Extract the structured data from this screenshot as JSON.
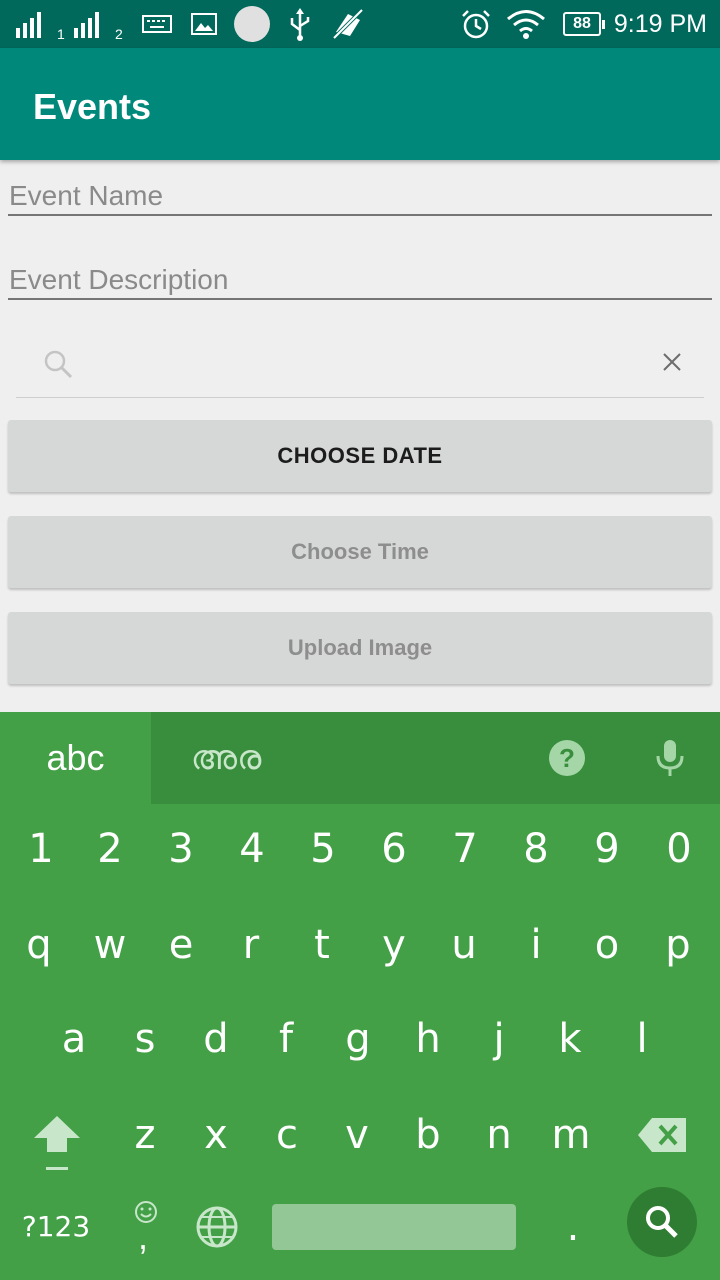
{
  "status_bar": {
    "sim1_label": "1",
    "sim2_label": "2",
    "battery": "88",
    "time": "9:19 PM"
  },
  "app_bar": {
    "title": "Events"
  },
  "form": {
    "event_name_hint": "Event Name",
    "event_description_hint": "Event Description",
    "search_value": "",
    "choose_date_label": "CHOOSE DATE",
    "choose_time_label": "Choose Time",
    "upload_image_label": "Upload Image"
  },
  "keyboard": {
    "tab_abc": "abc",
    "tab_malayalam": "അര",
    "help_label": "?",
    "number_row": [
      "1",
      "2",
      "3",
      "4",
      "5",
      "6",
      "7",
      "8",
      "9",
      "0"
    ],
    "row1": [
      "q",
      "w",
      "e",
      "r",
      "t",
      "y",
      "u",
      "i",
      "o",
      "p"
    ],
    "row2": [
      "a",
      "s",
      "d",
      "f",
      "g",
      "h",
      "j",
      "k",
      "l"
    ],
    "row3": [
      "z",
      "x",
      "c",
      "v",
      "b",
      "n",
      "m"
    ],
    "symbols_key": "?123",
    "comma_key": ",",
    "period_key": "."
  }
}
